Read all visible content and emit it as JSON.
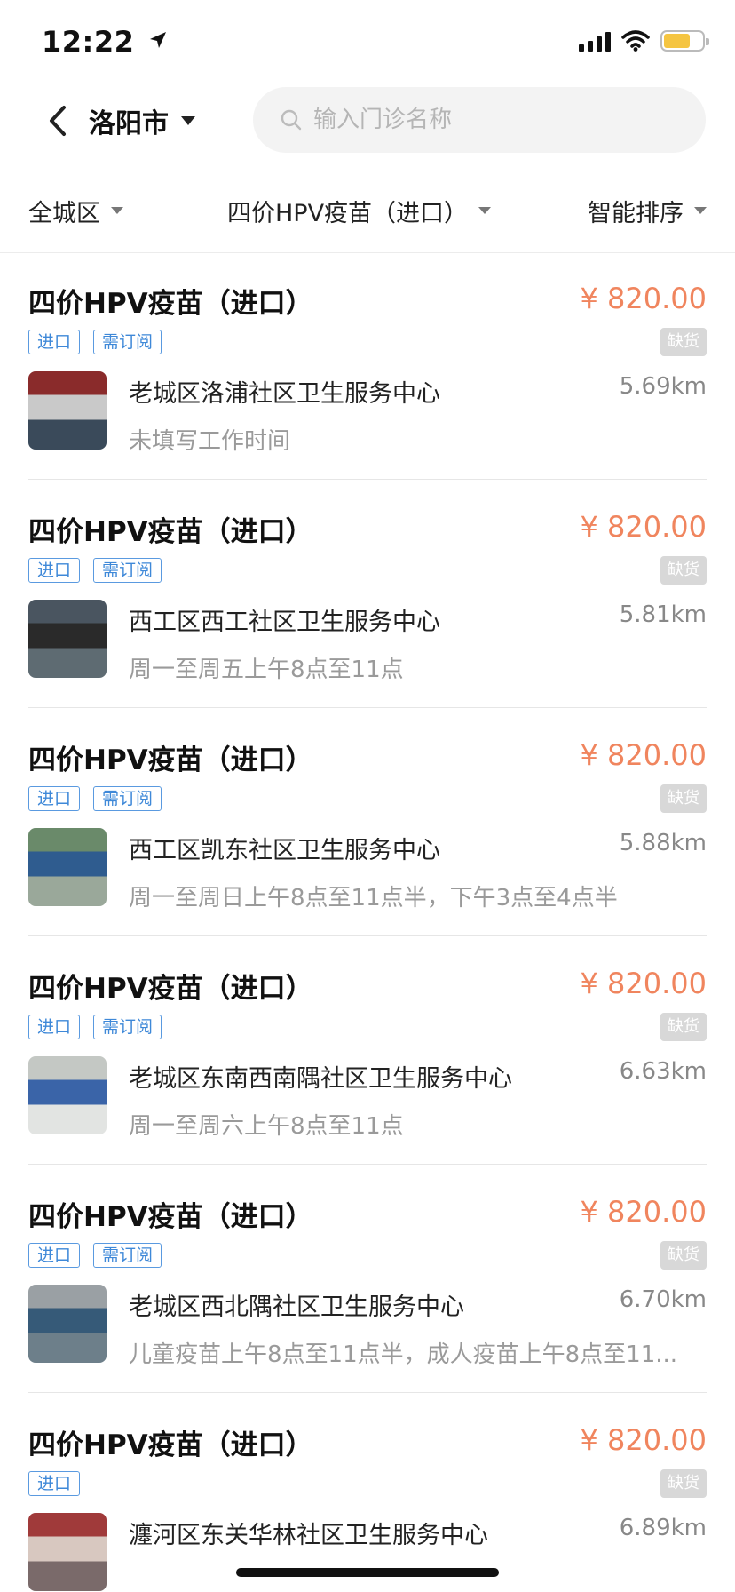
{
  "status": {
    "time": "12:22",
    "icons": [
      "location-arrow-icon",
      "signal-icon",
      "wifi-icon",
      "battery-icon"
    ],
    "battery_level": 0.7,
    "battery_color": "#f5c542"
  },
  "header": {
    "city": "洛阳市",
    "search_placeholder": "输入门诊名称"
  },
  "filters": {
    "district": "全城区",
    "vaccine": "四价HPV疫苗（进口）",
    "sort": "智能排序"
  },
  "colors": {
    "price": "#f0855e",
    "tag": "#3e88d8",
    "stock_badge": "#d8d8d8"
  },
  "items": [
    {
      "title": "四价HPV疫苗（进口）",
      "price": "¥ 820.00",
      "tags": [
        "进口",
        "需订阅"
      ],
      "stock": "缺货",
      "clinic": "老城区洛浦社区卫生服务中心",
      "distance": "5.69km",
      "hours": "未填写工作时间"
    },
    {
      "title": "四价HPV疫苗（进口）",
      "price": "¥ 820.00",
      "tags": [
        "进口",
        "需订阅"
      ],
      "stock": "缺货",
      "clinic": "西工区西工社区卫生服务中心",
      "distance": "5.81km",
      "hours": "周一至周五上午8点至11点"
    },
    {
      "title": "四价HPV疫苗（进口）",
      "price": "¥ 820.00",
      "tags": [
        "进口",
        "需订阅"
      ],
      "stock": "缺货",
      "clinic": "西工区凯东社区卫生服务中心",
      "distance": "5.88km",
      "hours": "周一至周日上午8点至11点半，下午3点至4点半"
    },
    {
      "title": "四价HPV疫苗（进口）",
      "price": "¥ 820.00",
      "tags": [
        "进口",
        "需订阅"
      ],
      "stock": "缺货",
      "clinic": "老城区东南西南隅社区卫生服务中心",
      "distance": "6.63km",
      "hours": "周一至周六上午8点至11点"
    },
    {
      "title": "四价HPV疫苗（进口）",
      "price": "¥ 820.00",
      "tags": [
        "进口",
        "需订阅"
      ],
      "stock": "缺货",
      "clinic": "老城区西北隅社区卫生服务中心",
      "distance": "6.70km",
      "hours": "儿童疫苗上午8点至11点半，成人疫苗上午8点至11..."
    },
    {
      "title": "四价HPV疫苗（进口）",
      "price": "¥ 820.00",
      "tags": [
        "进口"
      ],
      "stock": "缺货",
      "clinic": "瀍河区东关华林社区卫生服务中心",
      "distance": "6.89km",
      "hours": ""
    }
  ]
}
